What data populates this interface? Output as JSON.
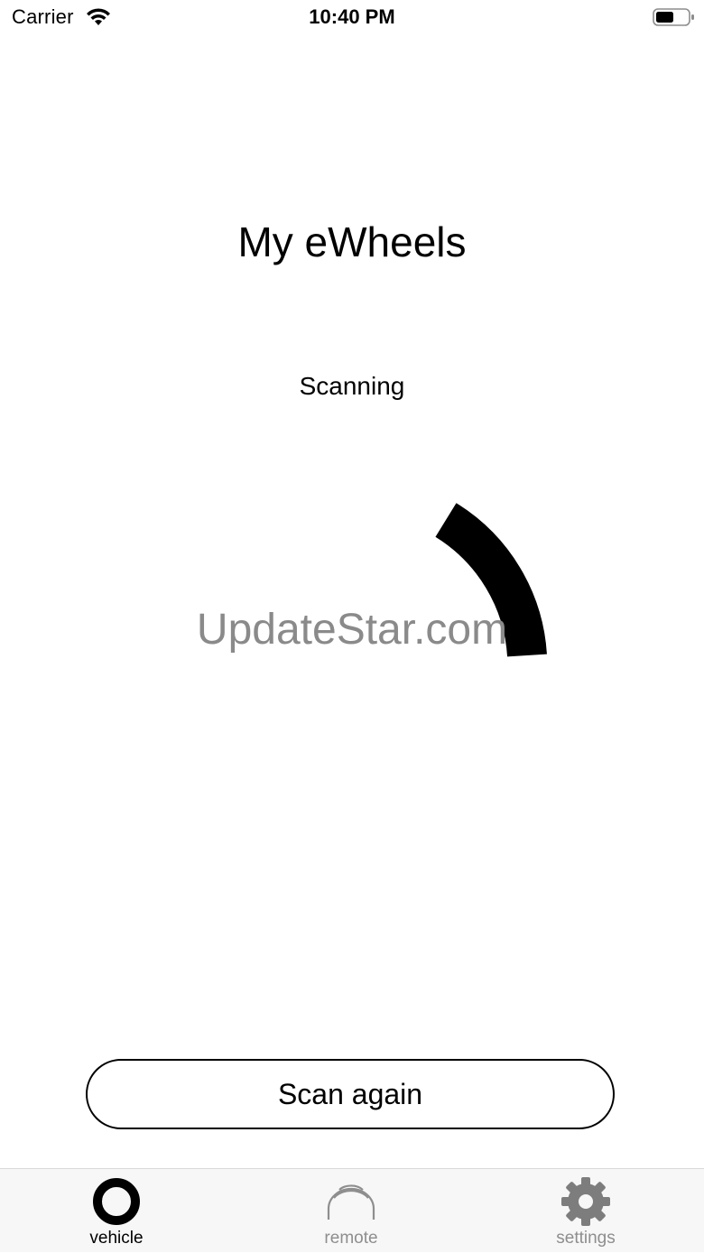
{
  "status_bar": {
    "carrier": "Carrier",
    "time": "10:40 PM",
    "wifi_icon": "wifi-icon",
    "battery_icon": "battery-icon",
    "battery_level": 0.55
  },
  "main": {
    "title": "My eWheels",
    "status_text": "Scanning",
    "watermark": "UpdateStar.com",
    "scan_button_label": "Scan again"
  },
  "tab_bar": {
    "tabs": [
      {
        "label": "vehicle",
        "icon": "ring-icon",
        "active": true
      },
      {
        "label": "remote",
        "icon": "remote-arc-icon",
        "active": false
      },
      {
        "label": "settings",
        "icon": "gear-icon",
        "active": false
      }
    ]
  },
  "colors": {
    "active_tab": "#000000",
    "inactive_tab": "#8e8e8e",
    "tab_bar_bg": "#f7f7f7",
    "watermark": "#8a8a8a"
  }
}
